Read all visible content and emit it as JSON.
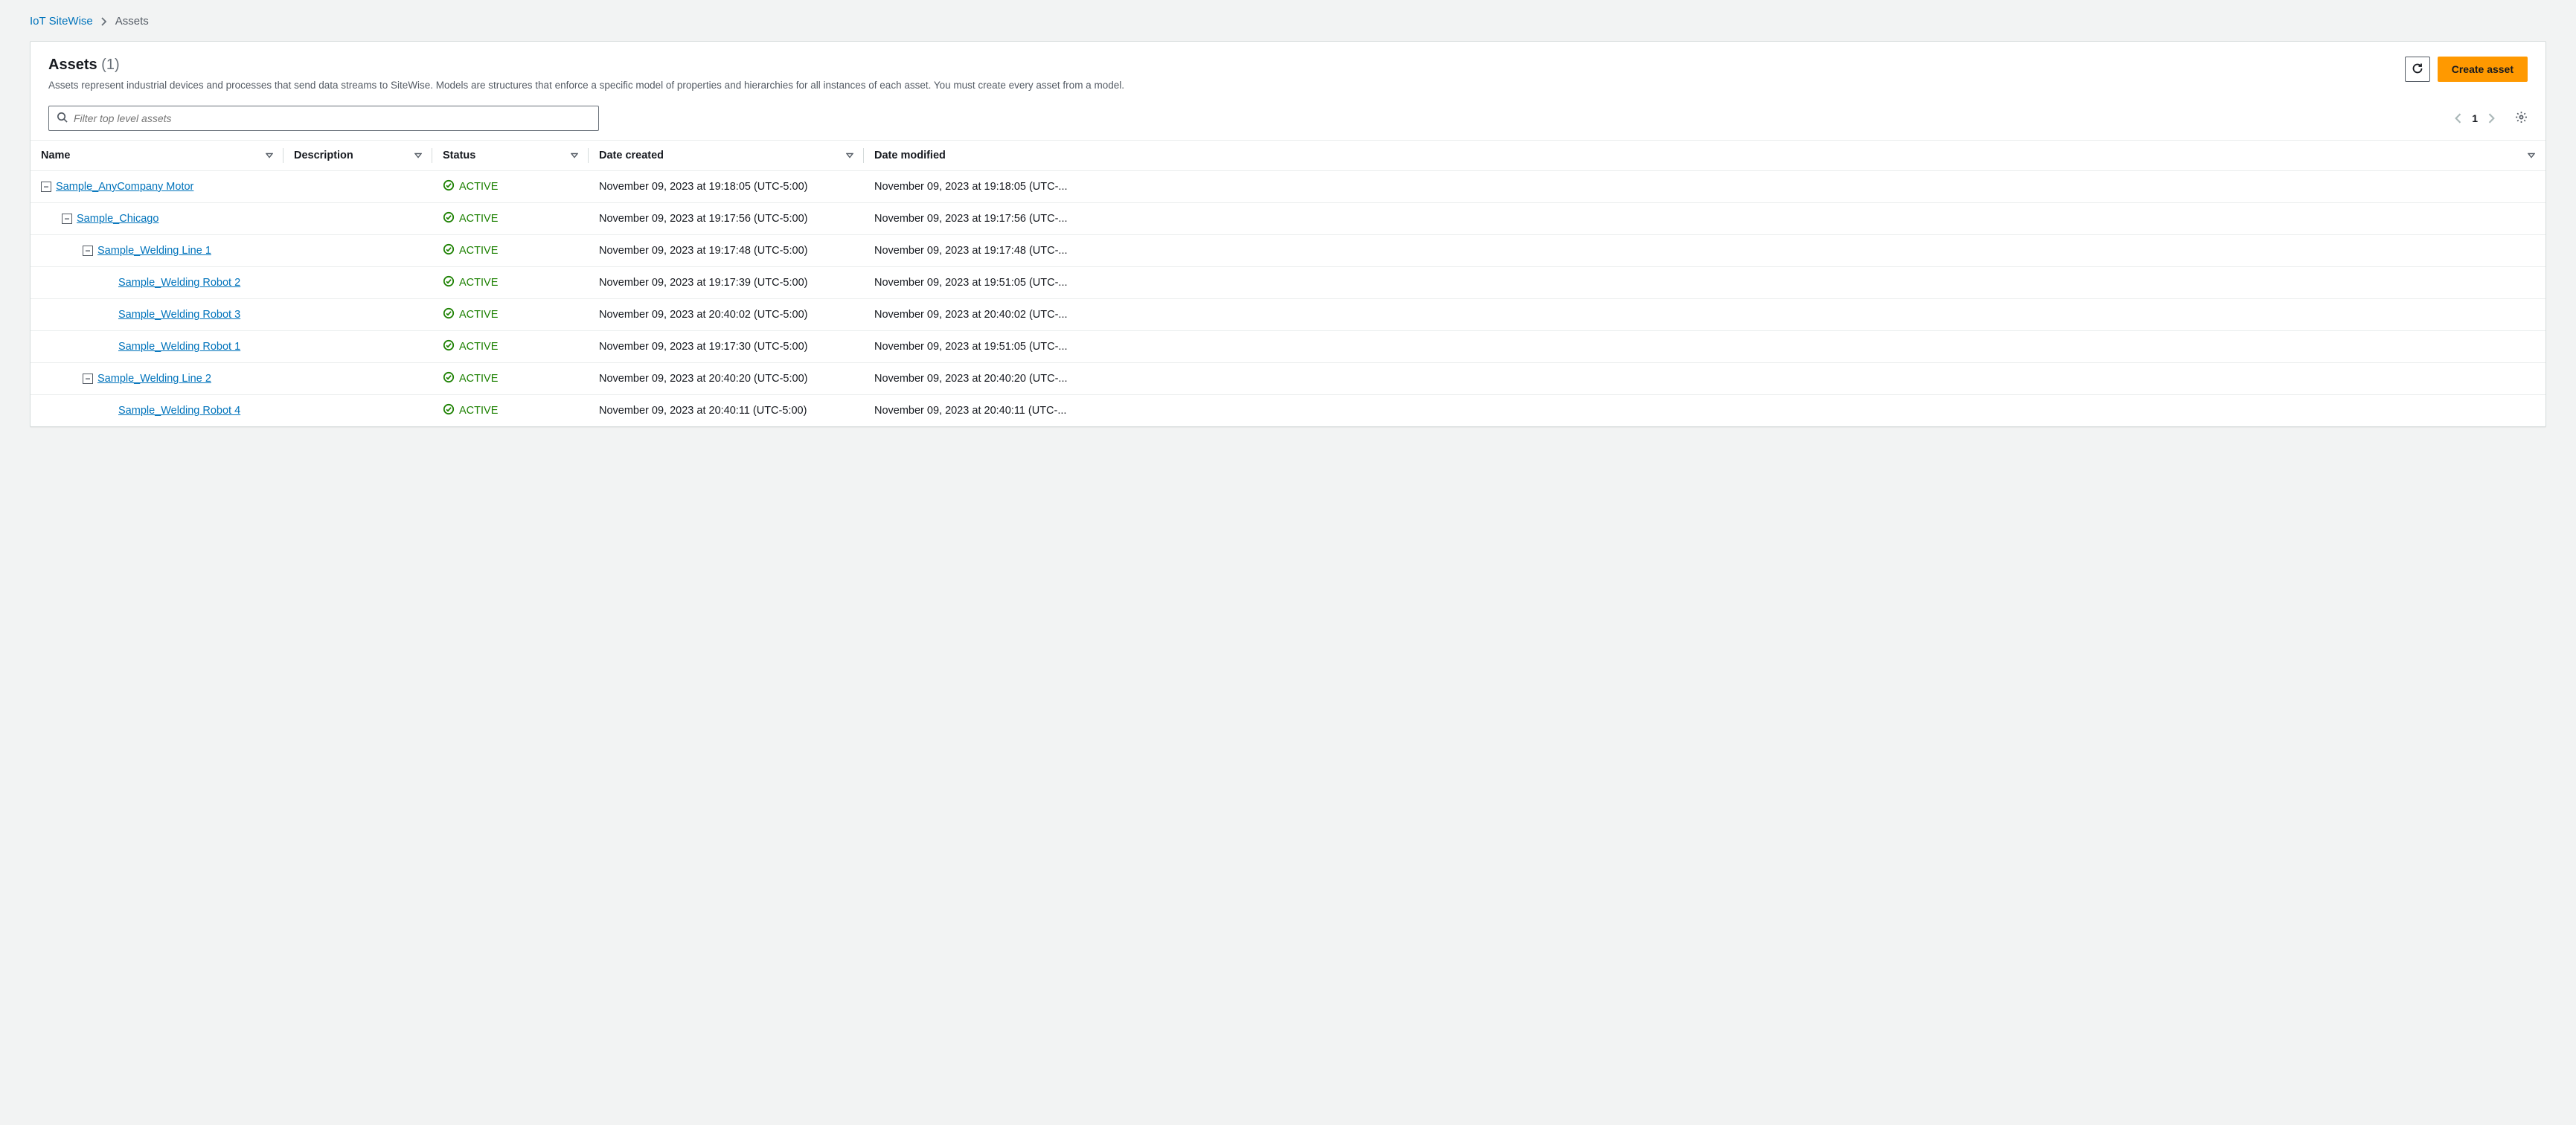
{
  "breadcrumb": {
    "root": "IoT SiteWise",
    "current": "Assets"
  },
  "header": {
    "title": "Assets",
    "count": "(1)",
    "description": "Assets represent industrial devices and processes that send data streams to SiteWise. Models are structures that enforce a specific model of properties and hierarchies for all instances of each asset. You must create every asset from a model.",
    "create_label": "Create asset"
  },
  "search": {
    "placeholder": "Filter top level assets"
  },
  "pager": {
    "page": "1"
  },
  "columns": {
    "name": "Name",
    "description": "Description",
    "status": "Status",
    "created": "Date created",
    "modified": "Date modified"
  },
  "status_label": "ACTIVE",
  "rows": [
    {
      "indent": 0,
      "toggle": "minus",
      "name": "Sample_AnyCompany Motor",
      "description": "",
      "status": "ACTIVE",
      "created": "November 09, 2023 at 19:18:05 (UTC-5:00)",
      "modified": "November 09, 2023 at 19:18:05 (UTC-..."
    },
    {
      "indent": 1,
      "toggle": "minus",
      "name": "Sample_Chicago",
      "description": "",
      "status": "ACTIVE",
      "created": "November 09, 2023 at 19:17:56 (UTC-5:00)",
      "modified": "November 09, 2023 at 19:17:56 (UTC-..."
    },
    {
      "indent": 2,
      "toggle": "minus",
      "name": "Sample_Welding Line 1",
      "description": "",
      "status": "ACTIVE",
      "created": "November 09, 2023 at 19:17:48 (UTC-5:00)",
      "modified": "November 09, 2023 at 19:17:48 (UTC-..."
    },
    {
      "indent": 3,
      "toggle": "none",
      "name": "Sample_Welding Robot 2",
      "description": "",
      "status": "ACTIVE",
      "created": "November 09, 2023 at 19:17:39 (UTC-5:00)",
      "modified": "November 09, 2023 at 19:51:05 (UTC-..."
    },
    {
      "indent": 3,
      "toggle": "none",
      "name": "Sample_Welding Robot 3",
      "description": "",
      "status": "ACTIVE",
      "created": "November 09, 2023 at 20:40:02 (UTC-5:00)",
      "modified": "November 09, 2023 at 20:40:02 (UTC-..."
    },
    {
      "indent": 3,
      "toggle": "none",
      "name": "Sample_Welding Robot 1",
      "description": "",
      "status": "ACTIVE",
      "created": "November 09, 2023 at 19:17:30 (UTC-5:00)",
      "modified": "November 09, 2023 at 19:51:05 (UTC-..."
    },
    {
      "indent": 2,
      "toggle": "minus",
      "name": "Sample_Welding Line 2",
      "description": "",
      "status": "ACTIVE",
      "created": "November 09, 2023 at 20:40:20 (UTC-5:00)",
      "modified": "November 09, 2023 at 20:40:20 (UTC-..."
    },
    {
      "indent": 3,
      "toggle": "none",
      "name": "Sample_Welding Robot 4",
      "description": "",
      "status": "ACTIVE",
      "created": "November 09, 2023 at 20:40:11 (UTC-5:00)",
      "modified": "November 09, 2023 at 20:40:11 (UTC-..."
    }
  ]
}
